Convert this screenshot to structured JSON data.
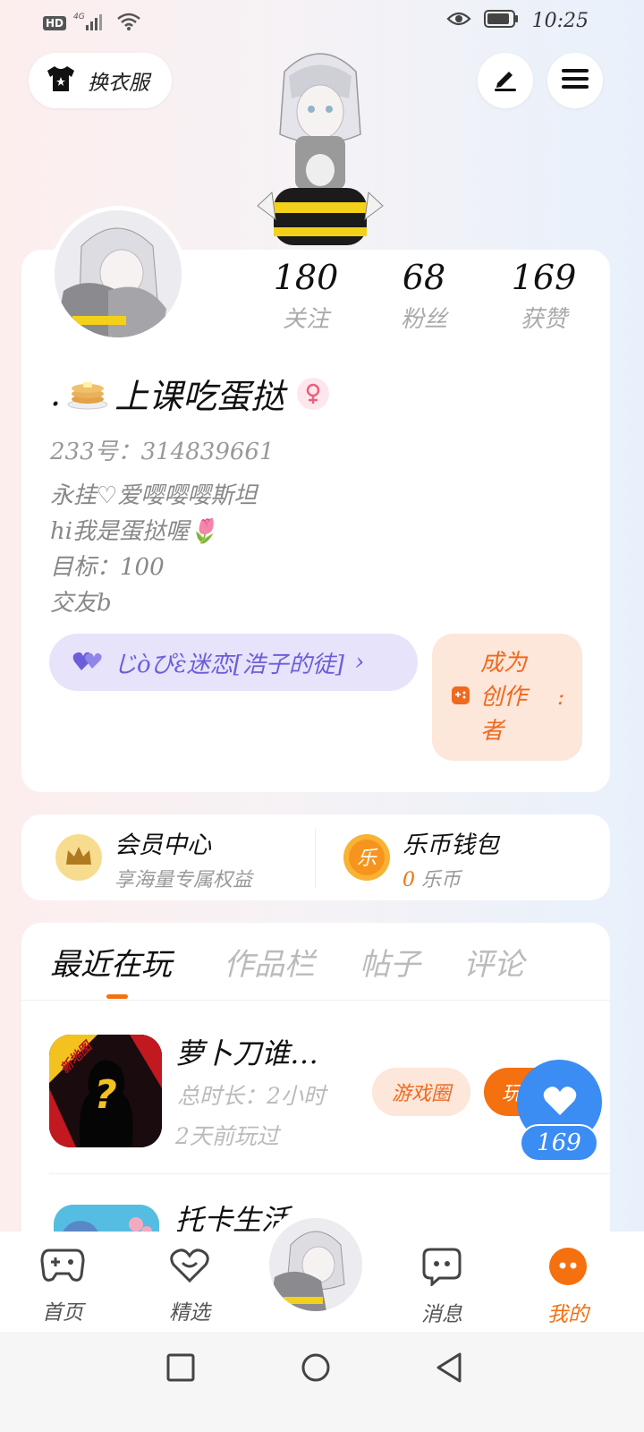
{
  "status_bar": {
    "hd": "HD",
    "network": "4G",
    "time": "10:25"
  },
  "header": {
    "outfit_label": "换衣服"
  },
  "profile": {
    "stats": [
      {
        "value": "180",
        "label": "关注"
      },
      {
        "value": "68",
        "label": "粉丝"
      },
      {
        "value": "169",
        "label": "获赞"
      }
    ],
    "name_prefix": ".",
    "name": "上课吃蛋挞",
    "uid": "233号：314839661",
    "bio_lines": [
      "永挂♡爱嘤嘤嘤斯坦",
      "hi我是蛋挞喔🌷",
      "目标：100",
      "交友b"
    ],
    "fan_group": "じὸぴὲ迷恋[浩子的徒]",
    "fan_group_chevron": "›",
    "creator_label": "成为创作者",
    "creator_colon": ":"
  },
  "member": {
    "vip_title": "会员中心",
    "vip_sub": "享海量专属权益",
    "wallet_title": "乐币钱包",
    "wallet_amount": "0",
    "wallet_unit": "乐币",
    "coin_glyph": "乐"
  },
  "tabs": [
    "最近在玩",
    "作品栏",
    "帖子",
    "评论"
  ],
  "recent_games": [
    {
      "title": "萝卜刀谁…",
      "duration": "总时长：2小时",
      "last_played": "2天前玩过",
      "badge": "新地图",
      "circle_label": "游戏圈",
      "play_label": "玩"
    },
    {
      "title": "托卡生活"
    }
  ],
  "like_count": "169",
  "bottom_nav": [
    {
      "label": "首页"
    },
    {
      "label": "精选"
    },
    {
      "label": "消息"
    },
    {
      "label": "我的"
    }
  ],
  "colors": {
    "accent": "#f5700f",
    "like_blue": "#3b8cf3",
    "fan_purple": "#6b5ed8"
  }
}
